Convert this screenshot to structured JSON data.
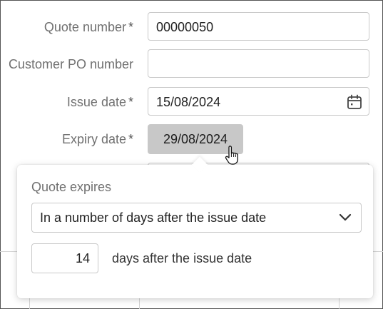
{
  "form": {
    "quote_number": {
      "label": "Quote number",
      "required_mark": "*",
      "value": "00000050"
    },
    "customer_po": {
      "label": "Customer PO number",
      "value": ""
    },
    "issue_date": {
      "label": "Issue date",
      "required_mark": "*",
      "value": "15/08/2024",
      "icon": "calendar-icon"
    },
    "expiry_date": {
      "label": "Expiry date",
      "required_mark": "*",
      "value": "29/08/2024"
    }
  },
  "popover": {
    "title": "Quote expires",
    "mode_select": {
      "value": "In a number of days after the issue date",
      "icon": "chevron-down-icon"
    },
    "days": {
      "value": "14",
      "suffix": "days after the issue date"
    }
  },
  "colors": {
    "label": "#707070",
    "border": "#c9c9c9",
    "chip_bg": "#c8c8c8"
  }
}
